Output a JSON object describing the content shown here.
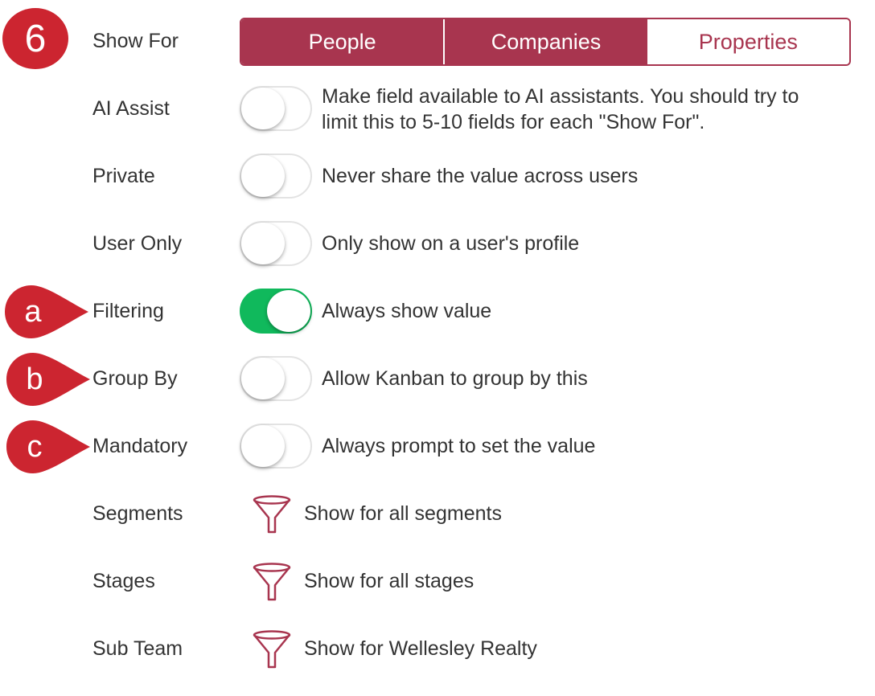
{
  "step_number": "6",
  "callouts": {
    "a": "a",
    "b": "b",
    "c": "c"
  },
  "colors": {
    "accent": "#a8354f",
    "toggle_on": "#10b95c",
    "callout": "#cc2530"
  },
  "show_for": {
    "label": "Show For",
    "options": [
      "People",
      "Companies",
      "Properties"
    ],
    "selected": [
      "People",
      "Companies"
    ]
  },
  "settings": [
    {
      "label": "AI Assist",
      "on": false,
      "desc_line1": "Make field available to AI assistants. You should try to",
      "desc_line2": "limit this to 5-10 fields for each \"Show For\"."
    },
    {
      "label": "Private",
      "on": false,
      "desc": "Never share the value across users"
    },
    {
      "label": "User Only",
      "on": false,
      "desc": "Only show on a user's profile"
    },
    {
      "label": "Filtering",
      "on": true,
      "desc": "Always show value"
    },
    {
      "label": "Group By",
      "on": false,
      "desc": "Allow Kanban to group by this"
    },
    {
      "label": "Mandatory",
      "on": false,
      "desc": "Always prompt to set the value"
    }
  ],
  "filters": [
    {
      "label": "Segments",
      "icon": "funnel-icon",
      "desc": "Show for all segments"
    },
    {
      "label": "Stages",
      "icon": "funnel-icon",
      "desc": "Show for all stages"
    },
    {
      "label": "Sub Team",
      "icon": "funnel-icon",
      "desc": "Show for Wellesley Realty"
    }
  ]
}
